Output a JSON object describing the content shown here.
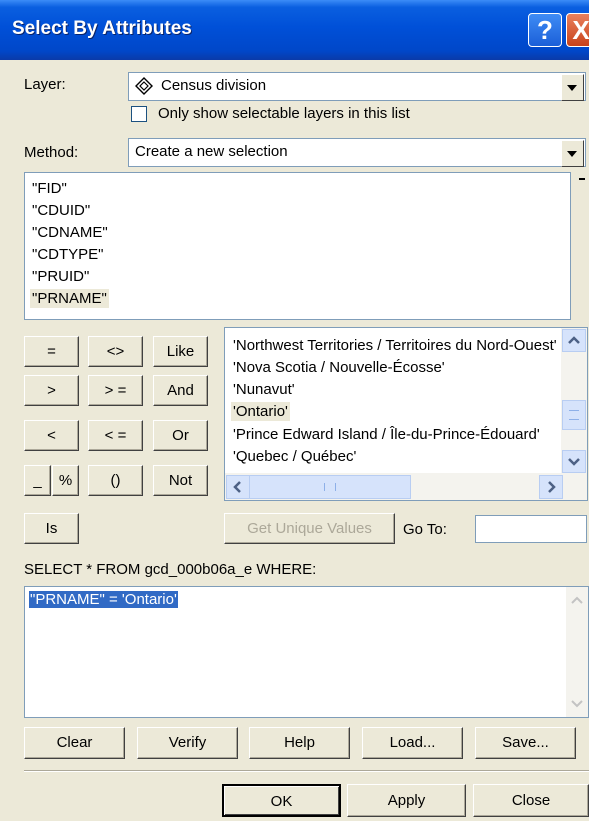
{
  "window": {
    "title": "Select By Attributes",
    "help_glyph": "?",
    "close_glyph": "X"
  },
  "layer": {
    "label": "Layer:",
    "value": "Census division",
    "icon": "layer-diamond-icon"
  },
  "only_selectable": {
    "label": "Only show selectable layers in this list",
    "checked": false
  },
  "method": {
    "label": "Method:",
    "value": "Create a new selection"
  },
  "fields": [
    "\"FID\"",
    "\"CDUID\"",
    "\"CDNAME\"",
    "\"CDTYPE\"",
    "\"PRUID\"",
    "\"PRNAME\""
  ],
  "selected_field": "\"PRNAME\"",
  "operators": {
    "eq": "=",
    "ne": "<>",
    "like": "Like",
    "gt": ">",
    "ge": "> =",
    "and": "And",
    "lt": "<",
    "le": "< =",
    "or": "Or",
    "underscore": "_",
    "percent": "%",
    "paren": "()",
    "not": "Not",
    "is": "Is"
  },
  "values": [
    "'Northwest Territories / Territoires du Nord-Ouest'",
    "'Nova Scotia / Nouvelle-Écosse'",
    "'Nunavut'",
    "'Ontario'",
    "'Prince Edward Island / Île-du-Prince-Édouard'",
    "'Quebec / Québec'"
  ],
  "selected_value": "'Ontario'",
  "get_unique_values": "Get Unique Values",
  "goto_label": "Go To:",
  "goto_value": "",
  "sql_prefix": "SELECT * FROM gcd_000b06a_e WHERE:",
  "sql_query": "\"PRNAME\" = 'Ontario'",
  "buttons": {
    "clear": "Clear",
    "verify": "Verify",
    "help": "Help",
    "load": "Load...",
    "save": "Save...",
    "ok": "OK",
    "apply": "Apply",
    "close": "Close"
  }
}
